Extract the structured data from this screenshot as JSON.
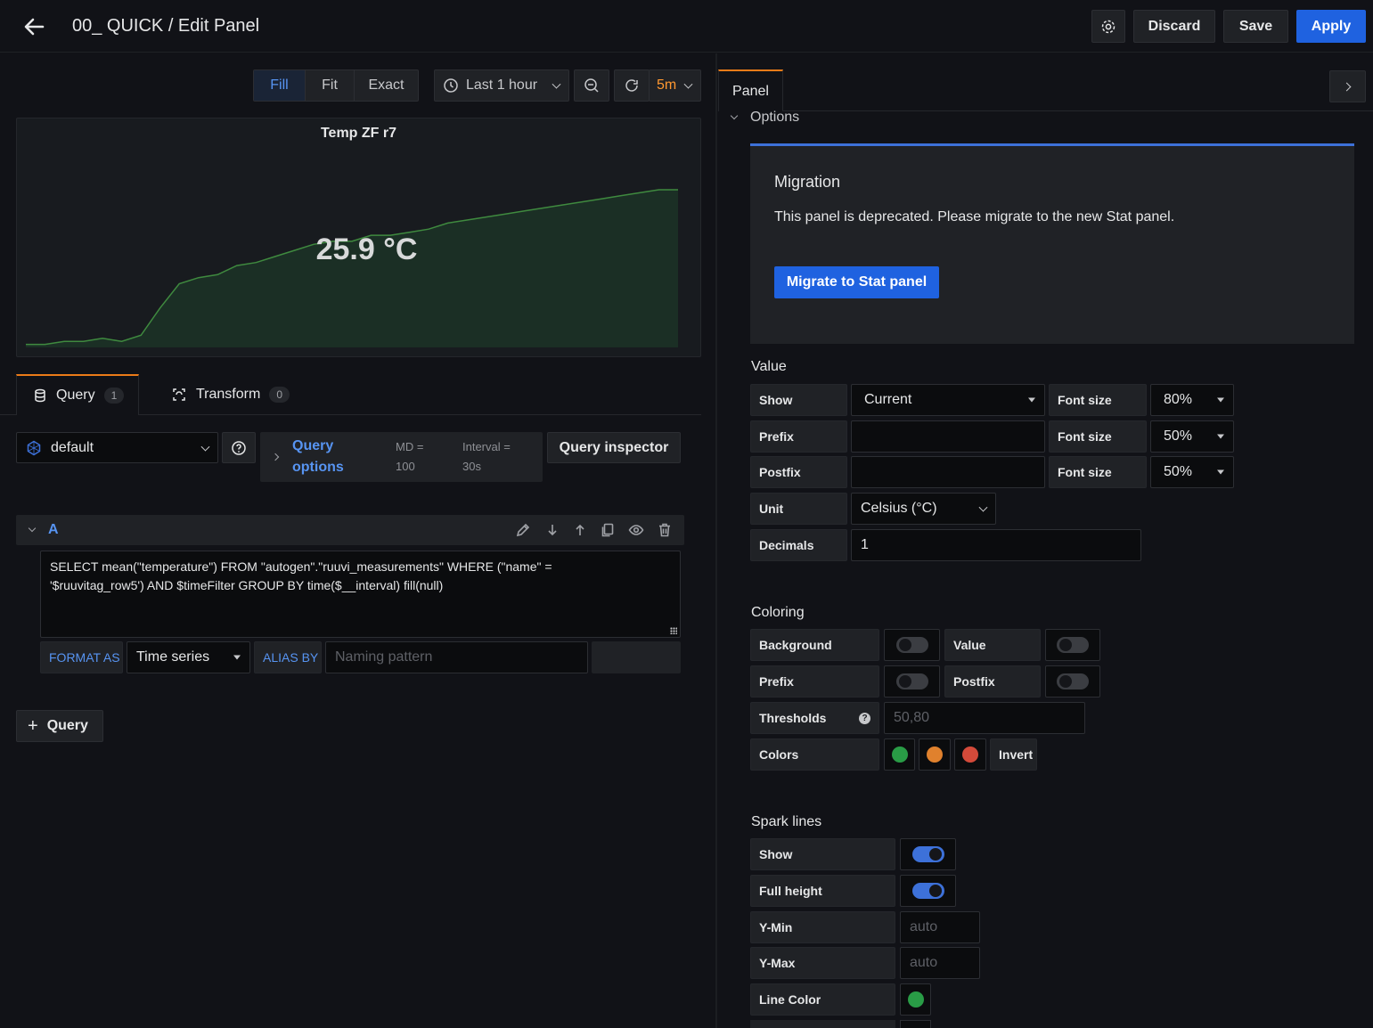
{
  "header": {
    "title": "00_ QUICK / Edit Panel",
    "discard_label": "Discard",
    "save_label": "Save",
    "apply_label": "Apply"
  },
  "toolbar": {
    "fill": "Fill",
    "fit": "Fit",
    "exact": "Exact",
    "time_range": "Last 1 hour",
    "refresh_interval": "5m"
  },
  "preview": {
    "title": "Temp ZF r7",
    "value": "25.9 °C"
  },
  "chart_data": {
    "type": "area",
    "values": [
      20.8,
      20.8,
      20.9,
      20.9,
      21.0,
      20.9,
      21.1,
      22.0,
      22.8,
      23.0,
      23.1,
      23.4,
      23.5,
      23.7,
      23.9,
      24.1,
      24.2,
      24.2,
      24.4,
      24.4,
      24.5,
      24.6,
      24.8,
      24.9,
      25.0,
      25.1,
      25.2,
      25.3,
      25.4,
      25.5,
      25.6,
      25.7,
      25.8,
      25.9,
      25.9
    ]
  },
  "tabs": {
    "query": "Query",
    "query_count": "1",
    "transform": "Transform",
    "transform_count": "0"
  },
  "datasource": {
    "name": "default",
    "query_options_line1": "Query",
    "query_options_line2": "options",
    "md_line1": "MD =",
    "md_line2": "100",
    "interval_line1": "Interval =",
    "interval_line2": "30s",
    "inspector": "Query inspector"
  },
  "query_a": {
    "ref": "A",
    "text": "SELECT mean(\"temperature\") FROM \"autogen\".\"ruuvi_measurements\" WHERE (\"name\" =\n'$ruuvitag_row5') AND $timeFilter GROUP BY time($__interval) fill(null)",
    "format_as_label": "FORMAT AS",
    "format_as_value": "Time series",
    "alias_label": "ALIAS BY",
    "alias_placeholder": "Naming pattern"
  },
  "add_query": "Query",
  "options_pane": {
    "tab": "Panel",
    "options": "Options",
    "migration_title": "Migration",
    "migration_text": "This panel is deprecated. Please migrate to the new Stat panel.",
    "migrate_button": "Migrate to Stat panel",
    "value_title": "Value",
    "show_label": "Show",
    "show_value": "Current",
    "prefix_label": "Prefix",
    "postfix_label": "Postfix",
    "font_size_label": "Font size",
    "font_size_1": "80%",
    "font_size_2": "50%",
    "font_size_3": "50%",
    "unit_label": "Unit",
    "unit_value": "Celsius (°C)",
    "decimals_label": "Decimals",
    "decimals_value": "1",
    "coloring_title": "Coloring",
    "background_label": "Background",
    "value_label": "Value",
    "prefix2_label": "Prefix",
    "postfix2_label": "Postfix",
    "thresholds_label": "Thresholds",
    "thresholds_placeholder": "50,80",
    "colors_label": "Colors",
    "invert_label": "Invert",
    "color_1": "#299c46",
    "color_2": "#e0812d",
    "color_3": "#d44a3a",
    "spark_title": "Spark lines",
    "spark_show_label": "Show",
    "full_height_label": "Full height",
    "ymin_label": "Y-Min",
    "ymin_placeholder": "auto",
    "ymax_label": "Y-Max",
    "ymax_placeholder": "auto",
    "line_color_label": "Line Color",
    "line_color": "#299c46"
  }
}
